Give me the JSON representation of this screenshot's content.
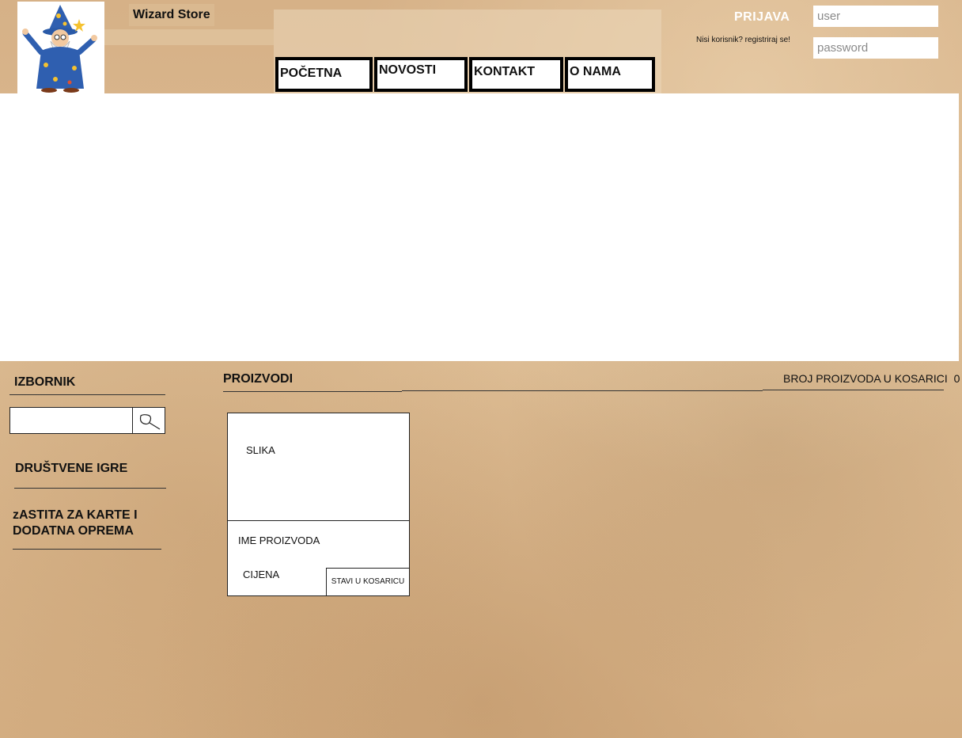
{
  "header": {
    "brand": "Wizard Store",
    "logo_icon": "wizard-logo-icon"
  },
  "nav": {
    "items": [
      {
        "label": "POČETNA"
      },
      {
        "label": "NOVOSTI"
      },
      {
        "label": "KONTAKT"
      },
      {
        "label": "O NAMA"
      }
    ]
  },
  "login": {
    "title": "PRIJAVA",
    "register_text": "Nisi korisnik? registriraj se!",
    "user_placeholder": "user",
    "password_placeholder": "password"
  },
  "sidebar": {
    "heading": "IZBORNIK",
    "search_placeholder": "",
    "search_icon": "search-icon",
    "categories": [
      {
        "label": "DRUŠTVENE IGRE"
      },
      {
        "label": "zASTITA ZA KARTE I DODATNA OPREMA"
      }
    ]
  },
  "products": {
    "heading": "PROIZVODI",
    "cart_label": "BROJ PROIZVODA U KOSARICI",
    "cart_count": "0",
    "items": [
      {
        "image_label": "SLIKA",
        "name": "IME PROIZVODA",
        "price": "CIJENA",
        "add_label": "STAVI U KOSARICU"
      }
    ]
  }
}
